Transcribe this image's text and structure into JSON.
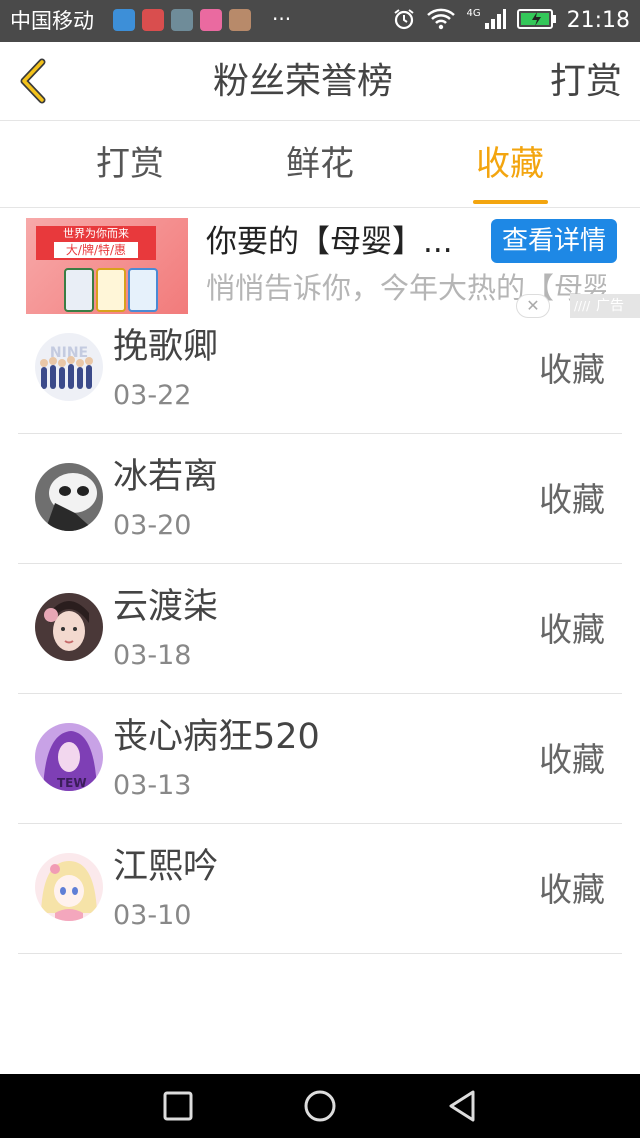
{
  "status_bar": {
    "carrier": "中国移动",
    "more": "···",
    "network": "4G",
    "time": "21:18",
    "app_icon_colors": [
      "#3d8fd8",
      "#d94e4e",
      "#6f8c99",
      "#ea6aa0",
      "#b88a6a"
    ]
  },
  "header": {
    "title": "粉丝荣誉榜",
    "right_action": "打赏"
  },
  "tabs": [
    {
      "label": "打赏",
      "active": false
    },
    {
      "label": "鲜花",
      "active": false
    },
    {
      "label": "收藏",
      "active": true
    }
  ],
  "accent_color": "#f3a50f",
  "ad": {
    "title": "你要的【母婴】...",
    "description": "悄悄告诉你，今年大热的【母婴】优惠来啦",
    "button": "查看详情",
    "label": "广告",
    "image_banner_line1": "世界为你而来",
    "image_banner_line2": "大/牌/特/惠"
  },
  "list": [
    {
      "name": "挽歌卿",
      "date": "03-22",
      "action": "收藏",
      "avatar_icon": "group-avatar"
    },
    {
      "name": "冰若离",
      "date": "03-20",
      "action": "收藏",
      "avatar_icon": "panda-mask-avatar"
    },
    {
      "name": "云渡柒",
      "date": "03-18",
      "action": "收藏",
      "avatar_icon": "girl-avatar"
    },
    {
      "name": "丧心病狂520",
      "date": "03-13",
      "action": "收藏",
      "avatar_icon": "purple-hair-avatar"
    },
    {
      "name": "江熙吟",
      "date": "03-10",
      "action": "收藏",
      "avatar_icon": "anime-girl-avatar"
    }
  ]
}
